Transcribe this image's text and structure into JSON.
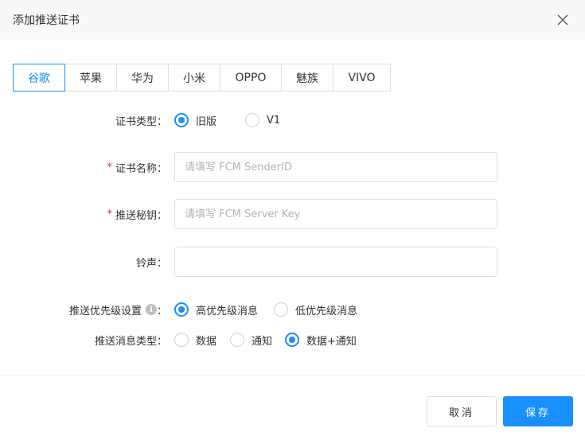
{
  "dialog": {
    "title": "添加推送证书"
  },
  "tabs": [
    {
      "label": "谷歌",
      "active": true
    },
    {
      "label": "苹果",
      "active": false
    },
    {
      "label": "华为",
      "active": false
    },
    {
      "label": "小米",
      "active": false
    },
    {
      "label": "OPPO",
      "active": false
    },
    {
      "label": "魅族",
      "active": false
    },
    {
      "label": "VIVO",
      "active": false
    }
  ],
  "form": {
    "cert_type": {
      "label": "证书类型：",
      "options": [
        {
          "label": "旧版",
          "checked": true
        },
        {
          "label": "V1",
          "checked": false
        }
      ]
    },
    "cert_name": {
      "required_mark": "*",
      "label": "证书名称：",
      "value": "",
      "placeholder": "请填写 FCM SenderID"
    },
    "push_key": {
      "required_mark": "*",
      "label": "推送秘钥：",
      "value": "",
      "placeholder": "请填写 FCM Server Key"
    },
    "ringtone": {
      "label": "铃声：",
      "value": "",
      "placeholder": ""
    },
    "priority": {
      "label": "推送优先级设置",
      "info_icon": "i",
      "colon": "：",
      "options": [
        {
          "label": "高优先级消息",
          "checked": true
        },
        {
          "label": "低优先级消息",
          "checked": false
        }
      ]
    },
    "message_type": {
      "label": "推送消息类型：",
      "options": [
        {
          "label": "数据",
          "checked": false
        },
        {
          "label": "通知",
          "checked": false
        },
        {
          "label": "数据+通知",
          "checked": true
        }
      ]
    }
  },
  "footer": {
    "cancel_label": "取消",
    "save_label": "保存"
  },
  "colors": {
    "accent": "#1890ff",
    "required": "#f5222d",
    "header_bg": "#f7f8fa",
    "border": "#dcdfe6"
  }
}
